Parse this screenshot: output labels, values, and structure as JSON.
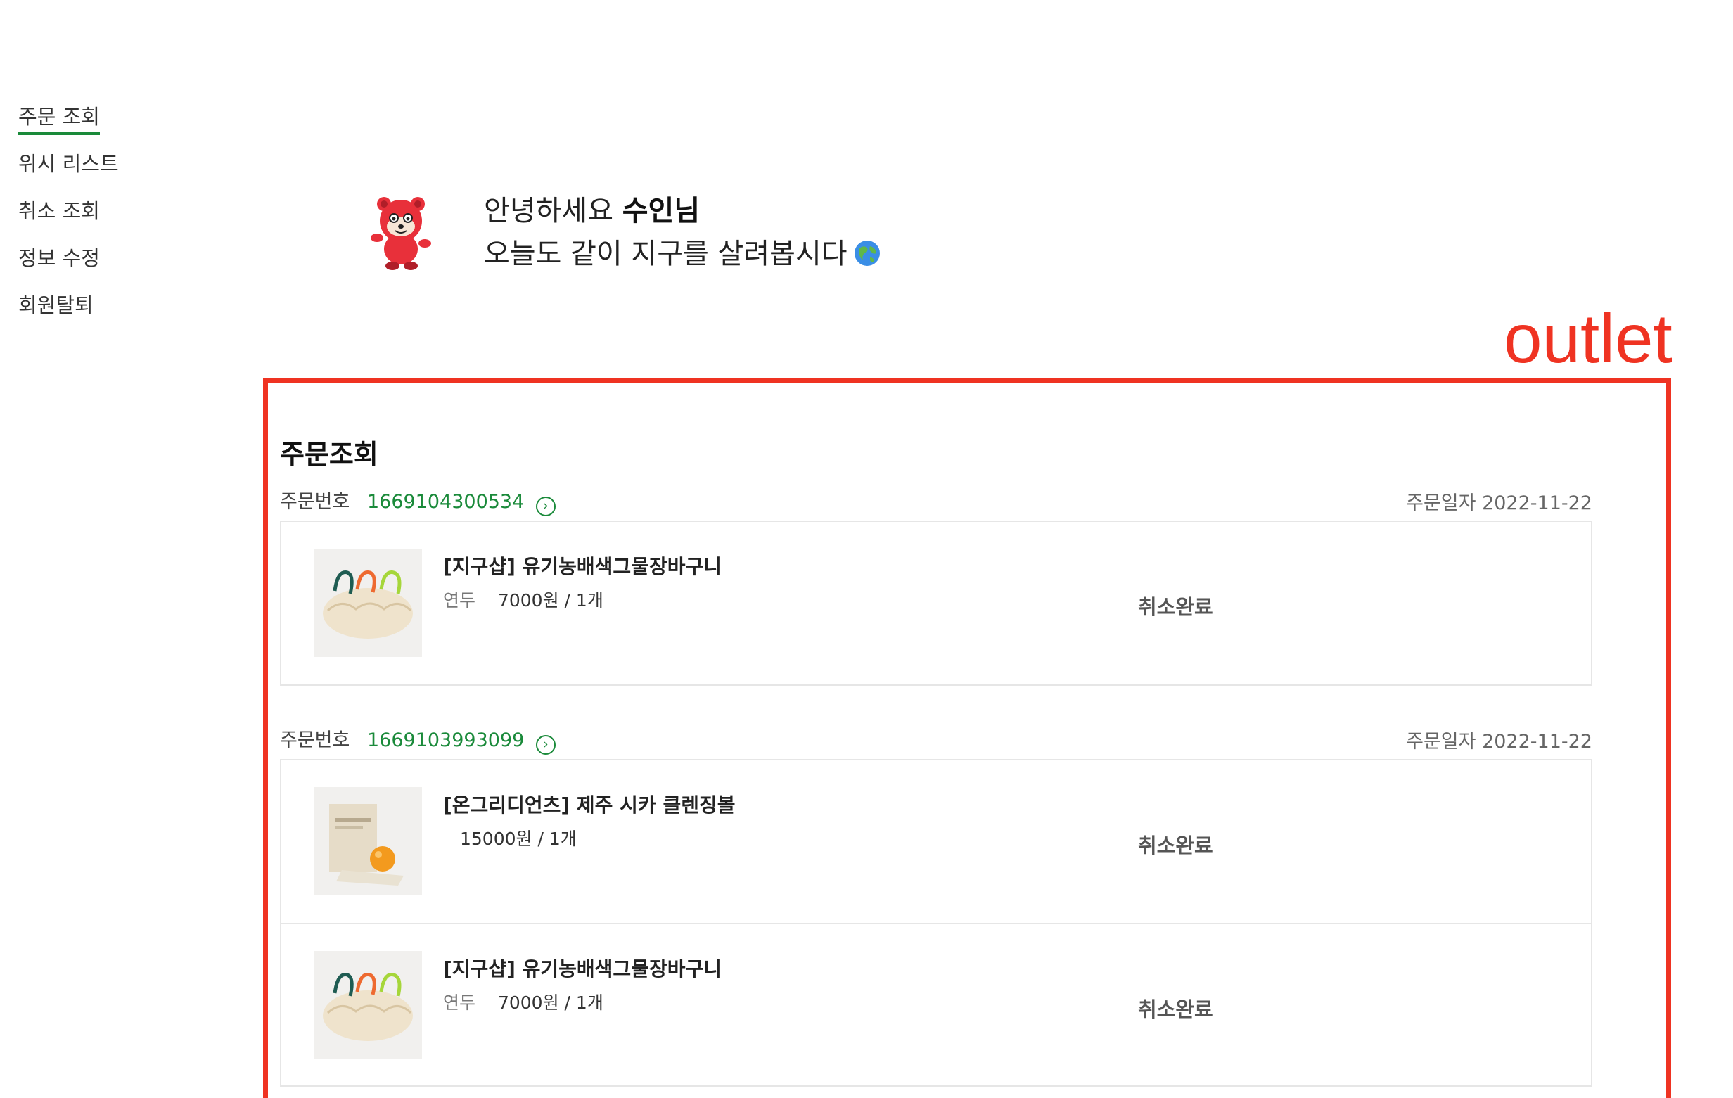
{
  "sidebar": {
    "items": [
      {
        "label": "주문 조회",
        "active": true
      },
      {
        "label": "위시 리스트"
      },
      {
        "label": "취소 조회"
      },
      {
        "label": "정보 수정"
      },
      {
        "label": "회원탈퇴"
      }
    ]
  },
  "greeting": {
    "line1_prefix": "안녕하세요",
    "name": "수인님",
    "line2": "오늘도 같이 지구를 살려봅시다"
  },
  "annotation": {
    "label": "outlet"
  },
  "orders": {
    "title": "주문조회",
    "order_number_label": "주문번호",
    "order_date_label": "주문일자",
    "list": [
      {
        "number": "1669104300534",
        "date": "2022-11-22",
        "items": [
          {
            "name": "[지구샵] 유기농배색그물장바구니",
            "option": "연두",
            "price": "7000원 / 1개",
            "status": "취소완료",
            "image": "mesh-bag-image"
          }
        ]
      },
      {
        "number": "1669103993099",
        "date": "2022-11-22",
        "items": [
          {
            "name": "[온그리디언츠] 제주 시카 클렌징볼",
            "option": "",
            "price": "15000원 / 1개",
            "status": "취소완료",
            "image": "cleansing-ball-image"
          },
          {
            "name": "[지구샵] 유기농배색그물장바구니",
            "option": "연두",
            "price": "7000원 / 1개",
            "status": "취소완료",
            "image": "mesh-bag-image"
          }
        ]
      }
    ]
  },
  "colors": {
    "accent_green": "#1a8a3a",
    "annotation_red": "#ef3322"
  }
}
